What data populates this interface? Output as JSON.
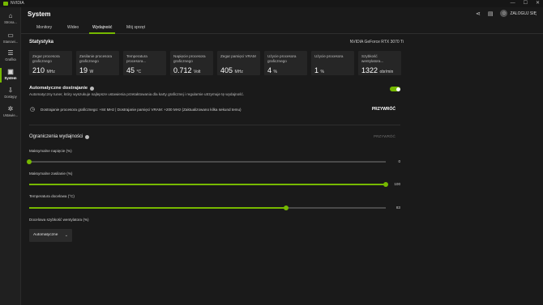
{
  "window": {
    "app_name": "NVIDIA",
    "controls": [
      "—",
      "☐",
      "✕"
    ]
  },
  "sidebar": {
    "items": [
      {
        "label": "Strona...",
        "icon": "home-icon",
        "active": false
      },
      {
        "label": "Stanowi...",
        "icon": "desktop-icon",
        "active": false
      },
      {
        "label": "Grafika",
        "icon": "sliders-icon",
        "active": false
      },
      {
        "label": "System",
        "icon": "system-icon",
        "active": true
      },
      {
        "label": "Dostępy",
        "icon": "download-icon",
        "active": false
      },
      {
        "label": "Ustawie...",
        "icon": "gear-icon",
        "active": false
      }
    ]
  },
  "header": {
    "title": "System",
    "login_label": "ZALOGUJ SIĘ"
  },
  "tabs": [
    {
      "label": "Monitory",
      "active": false
    },
    {
      "label": "Wideo",
      "active": false
    },
    {
      "label": "Wydajność",
      "active": true
    },
    {
      "label": "Mój sprzęt",
      "active": false
    }
  ],
  "stats": {
    "title": "Statystyka",
    "gpu_name": "NVIDIA GeForce RTX 3070 Ti",
    "cards": [
      {
        "label": "Zegar procesora graficznego",
        "value": "210",
        "unit": "MHz"
      },
      {
        "label": "Zasilanie procesora graficznego",
        "value": "19",
        "unit": "W"
      },
      {
        "label": "Temperatura procesora...",
        "value": "45",
        "unit": "°C"
      },
      {
        "label": "Napięcie procesora graficznego",
        "value": "0.712",
        "unit": "Volt"
      },
      {
        "label": "Zegar pamięci VRAM",
        "value": "405",
        "unit": "MHz"
      },
      {
        "label": "Użycie procesora graficznego",
        "value": "4",
        "unit": "%"
      },
      {
        "label": "Użycie procesora",
        "value": "1",
        "unit": "%"
      },
      {
        "label": "Szybkość wentylatora...",
        "value": "1322",
        "unit": "obr/min"
      }
    ]
  },
  "auto_tuning": {
    "title": "Automatyczne dostrajanie",
    "description": "Automatyczny tuner, który wyszukuje najlepsze ustawienia przetaktowania dla karty graficznej i regularnie utrzymuje tę wydajność.",
    "enabled": true,
    "status": "Dostrajanie procesora graficznego: +84 MHz   |   Dostrajanie pamięci VRAM: +200 MHz (Zaktualizowano kilka sekund temu)",
    "restore_label": "PRZYWRÓĆ"
  },
  "limits": {
    "title": "Ograniczenia wydajności",
    "restore_label": "PRZYWRÓĆ",
    "sliders": [
      {
        "label": "Maksymalne napięcie (%)",
        "value": "0",
        "fraction": 0.0
      },
      {
        "label": "Maksymalne zasilanie (%)",
        "value": "100",
        "fraction": 1.0
      },
      {
        "label": "Temperatura docelowa (°C)",
        "value": "83",
        "fraction": 0.72
      }
    ],
    "fan": {
      "label": "Docelowa szybkość wentylatora (%)",
      "value": "Automatyczne"
    }
  },
  "colors": {
    "accent": "#76b900"
  }
}
